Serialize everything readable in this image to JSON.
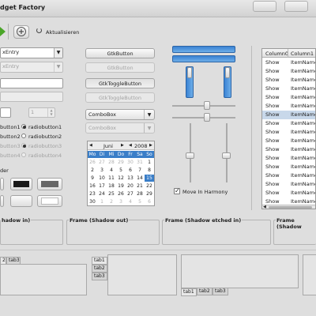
{
  "window": {
    "title": "dget Factory"
  },
  "toolbar": {
    "refresh_label": "Aktualisieren"
  },
  "entries": {
    "combo_entry_1": "xEntry",
    "combo_entry_2": "xEntry",
    "spin_1_value": "1",
    "spin_2_value": "1"
  },
  "buttons": {
    "gtk_button": "GtkButton",
    "gtk_button_disabled": "GtkButton",
    "toggle_button": "GtkToggleButton",
    "toggle_button_disabled": "GtkToggleButton"
  },
  "combos": {
    "combo_1": "ComboBox",
    "combo_2": "ComboBox"
  },
  "radios": {
    "left": [
      "button1",
      "button2",
      "button3",
      "button4"
    ],
    "right": [
      "radiobutton1",
      "radiobutton2",
      "radiobutton3",
      "radiobutton4"
    ]
  },
  "partial_label_left": "der",
  "calendar": {
    "month": "Juni",
    "year": "2008",
    "weekdays": [
      "Mo",
      "Di",
      "Mi",
      "Do",
      "Fr",
      "Sa",
      "So"
    ],
    "rows": [
      [
        "26",
        "27",
        "28",
        "29",
        "30",
        "31",
        "1"
      ],
      [
        "2",
        "3",
        "4",
        "5",
        "6",
        "7",
        "8"
      ],
      [
        "9",
        "10",
        "11",
        "12",
        "13",
        "14",
        "15"
      ],
      [
        "16",
        "17",
        "18",
        "19",
        "20",
        "21",
        "22"
      ],
      [
        "23",
        "24",
        "25",
        "26",
        "27",
        "28",
        "29"
      ],
      [
        "30",
        "1",
        "2",
        "3",
        "4",
        "5",
        "6"
      ]
    ],
    "selected": "15"
  },
  "move_in_harmony": {
    "label": "Move In Harmony",
    "checked": true
  },
  "tree": {
    "columns": [
      "Column0",
      "Column1"
    ],
    "rows": [
      [
        "Show",
        "ItemName"
      ],
      [
        "Show",
        "ItemName"
      ],
      [
        "Show",
        "ItemName"
      ],
      [
        "Show",
        "ItemName"
      ],
      [
        "Show",
        "ItemName"
      ],
      [
        "Show",
        "ItemName"
      ],
      [
        "Show",
        "ItemName"
      ],
      [
        "Show",
        "ItemName"
      ],
      [
        "Show",
        "ItemName"
      ],
      [
        "Show",
        "ItemName"
      ],
      [
        "Show",
        "ItemName"
      ],
      [
        "Show",
        "ItemName"
      ],
      [
        "Show",
        "ItemName"
      ],
      [
        "Show",
        "ItemName"
      ],
      [
        "Show",
        "ItemName"
      ],
      [
        "Show",
        "ItemName"
      ],
      [
        "Show",
        "ItemName"
      ]
    ],
    "selected_row": 6
  },
  "frames": {
    "shadow_in": "hadow in)",
    "shadow_out": "Frame (Shadow out)",
    "shadow_etched_in": "Frame (Shadow etched in)",
    "shadow_cut": "Frame (Shadow"
  },
  "notebooks": {
    "left_tabs": [
      "2",
      "tab3"
    ],
    "left_vertical_tabs": [
      "tab1",
      "tab2",
      "tab3"
    ],
    "bottom_tabs": [
      "tab1",
      "tab2",
      "tab3"
    ]
  },
  "colors": {
    "selection": "#3a83d4",
    "calendar_header": "#3a7ec8"
  }
}
